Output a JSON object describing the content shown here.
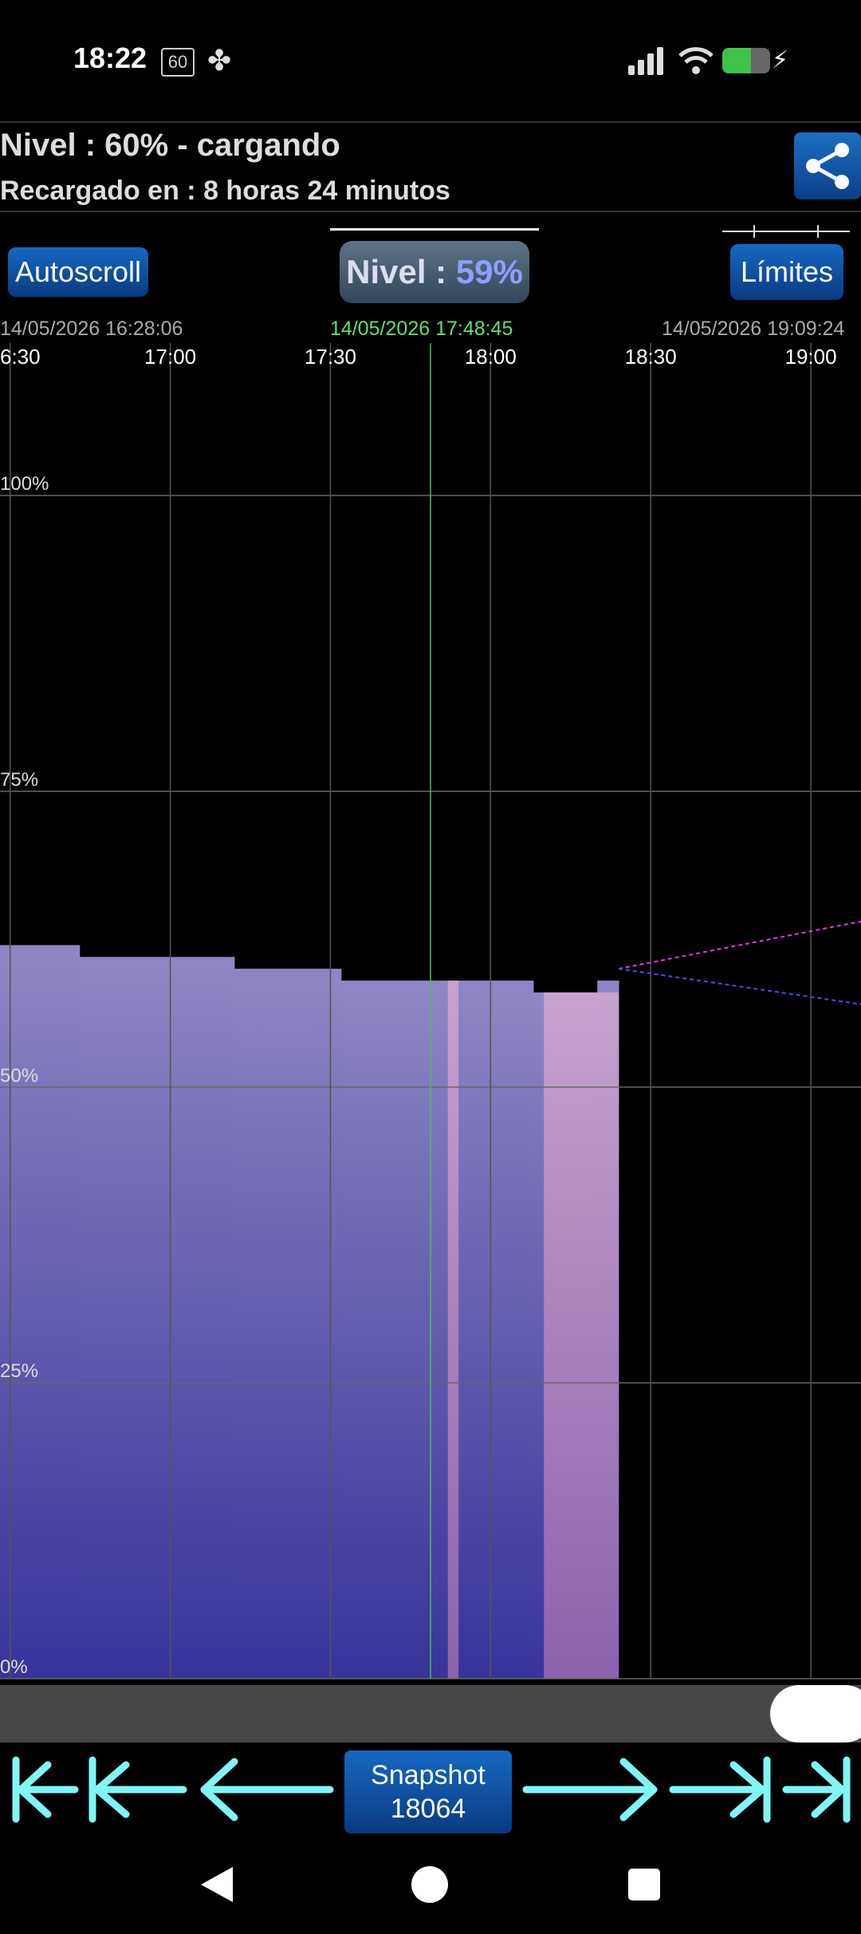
{
  "status_bar": {
    "time": "18:22",
    "refresh_badge": "60",
    "icons": [
      "refresh-rate-icon",
      "fan-icon",
      "signal-icon",
      "wifi-icon",
      "battery-charging-icon"
    ],
    "battery_level": 0.6,
    "battery_color": "#3ec24a"
  },
  "header": {
    "level_text": "Nivel : 60% - cargando",
    "recharged_text": "Recargado en : 8 horas 24 minutos",
    "share_icon": "share-icon"
  },
  "toolbar": {
    "autoscroll_label": "Autoscroll",
    "nivel_label": "Nivel : ",
    "nivel_value": "59%",
    "limits_label": "Límites"
  },
  "timestamps": {
    "start": "14/05/2026 16:28:06",
    "cursor": "14/05/2026 17:48:45",
    "end": "14/05/2026 19:09:24"
  },
  "chart_data": {
    "type": "area",
    "title": "",
    "x_tick_labels": [
      "6:30",
      "17:00",
      "17:30",
      "18:00",
      "18:30",
      "19:00"
    ],
    "y_tick_labels": [
      "100%",
      "75%",
      "50%",
      "25%",
      "0%"
    ],
    "ylim": [
      0,
      100
    ],
    "xlim": [
      "16:28:06",
      "19:09:24"
    ],
    "cursor_time": "17:48:45",
    "series": [
      {
        "x": [
          "16:28:06",
          "16:43:00",
          "17:12:00",
          "17:32:00",
          "18:08:00",
          "18:14:00",
          "18:20:00",
          "18:24:00"
        ],
        "values": [
          62,
          61,
          60,
          59,
          58,
          58,
          59,
          60
        ],
        "color": "#8a84bf",
        "charging_intervals": [
          [
            "17:52:00",
            "17:54:00"
          ],
          [
            "18:10:00",
            "18:24:00"
          ]
        ],
        "charging_color": "#c8a3c8"
      }
    ],
    "projections": [
      {
        "color": "#e03ce0",
        "from": [
          "18:24:00",
          60
        ],
        "to": [
          "19:09:24",
          64
        ]
      },
      {
        "color": "#4a4aff",
        "from": [
          "18:24:00",
          60
        ],
        "to": [
          "19:09:24",
          57
        ]
      }
    ],
    "grid": true
  },
  "scrollbar": {
    "position": 1.0
  },
  "navigation": {
    "snapshot_label": "Snapshot",
    "snapshot_number": "18064",
    "icons": [
      "first-icon",
      "jump-back-icon",
      "back-icon",
      "forward-icon",
      "jump-forward-icon",
      "last-icon"
    ],
    "arrow_color": "#7ff6f6"
  },
  "system_nav": {
    "icons": [
      "back-triangle-icon",
      "home-circle-icon",
      "recents-square-icon"
    ]
  }
}
